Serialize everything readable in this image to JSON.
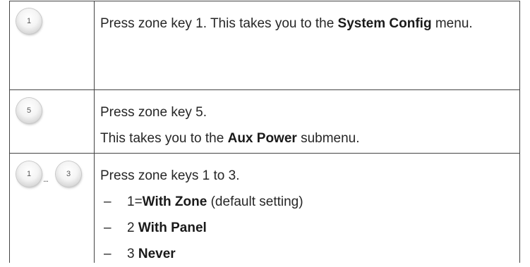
{
  "rows": [
    {
      "keys": [
        "1"
      ],
      "text_before": "Press zone key 1. This takes you to the ",
      "bold": "System Config",
      "text_after": " menu."
    },
    {
      "keys": [
        "5"
      ],
      "line1": "Press zone key 5.",
      "line2_before": "This takes you to the ",
      "line2_bold": "Aux Power",
      "line2_after": " submenu."
    },
    {
      "keys": [
        "1",
        "3"
      ],
      "separator": "...",
      "intro": "Press zone keys 1 to 3.",
      "options": [
        {
          "dash": "–",
          "prefix": "1=",
          "bold": "With Zone",
          "suffix": " (default setting)"
        },
        {
          "dash": "–",
          "prefix": "2 ",
          "bold": "With Panel",
          "suffix": ""
        },
        {
          "dash": "–",
          "prefix": "3 ",
          "bold": "Never",
          "suffix": ""
        }
      ]
    }
  ]
}
